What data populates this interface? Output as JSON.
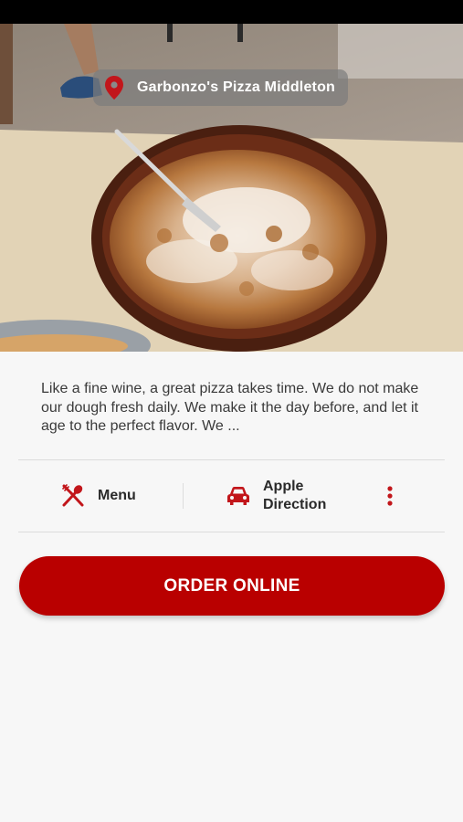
{
  "status_bar": {},
  "hero": {
    "image_subject": "cinnamon-pull-apart-pizza-photo",
    "location_name": "Garbonzo's Pizza Middleton",
    "pin_icon": "location-pin-icon",
    "accent_color": "#c2161b"
  },
  "restaurant": {
    "description": "Like a fine wine, a great pizza takes time. We do not make our dough fresh daily. We make it the day before, and let it age to the perfect flavor. We ..."
  },
  "actions": {
    "menu": {
      "icon": "utensils-icon",
      "label": "Menu"
    },
    "direction": {
      "icon": "car-icon",
      "label": "Apple Direction"
    },
    "more": {
      "icon": "more-vertical-icon"
    }
  },
  "order": {
    "label": "ORDER ONLINE",
    "color": "#b90000"
  }
}
